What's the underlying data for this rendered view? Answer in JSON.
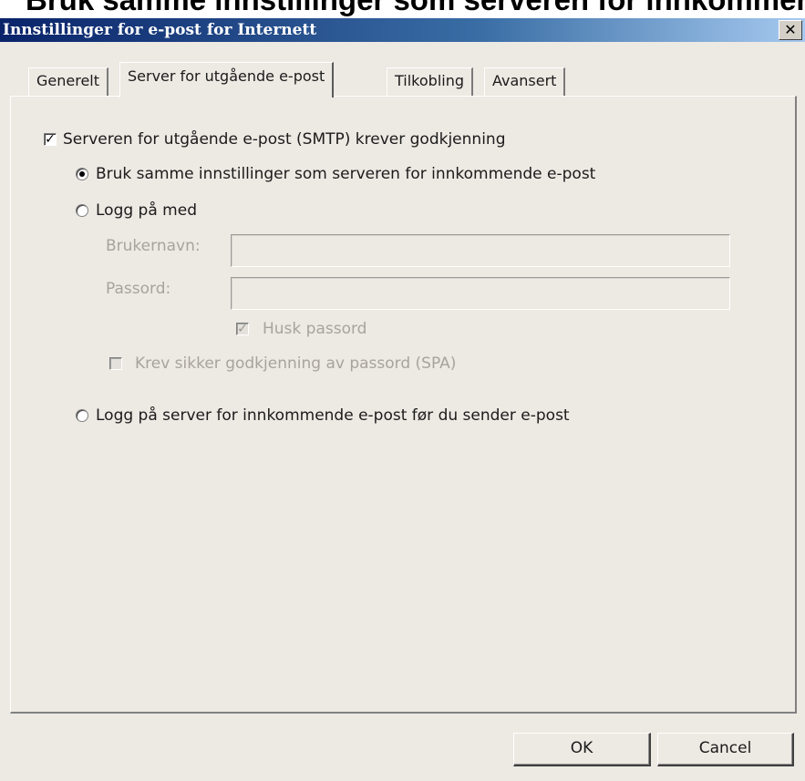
{
  "caption": "Bruk samme innstillinger som serveren for innkommende e-post",
  "window": {
    "title": "Innstillinger for e-post for Internett",
    "close_glyph": "✕",
    "close_icon": "close-icon"
  },
  "tabs": [
    {
      "label": "Generelt",
      "active": false
    },
    {
      "label": "Server for utgående e-post",
      "active": true
    },
    {
      "label": "Tilkobling",
      "active": false
    },
    {
      "label": "Avansert",
      "active": false
    }
  ],
  "panel": {
    "smtp_auth": {
      "label": "Serveren for utgående e-post (SMTP) krever godkjenning",
      "checked": true
    },
    "use_same_settings": {
      "label": "Bruk samme innstillinger som serveren for innkommende e-post",
      "selected": true
    },
    "log_on_with": {
      "label": "Logg på med",
      "selected": false
    },
    "username": {
      "label": "Brukernavn:",
      "value": "",
      "enabled": false
    },
    "password": {
      "label": "Passord:",
      "value": "",
      "enabled": false
    },
    "remember_password": {
      "label": "Husk passord",
      "checked": true,
      "enabled": false
    },
    "require_spa": {
      "label": "Krev sikker godkjenning av passord (SPA)",
      "checked": false,
      "enabled": false
    },
    "log_on_incoming_first": {
      "label": "Logg på server for innkommende e-post før du sender e-post",
      "selected": false
    }
  },
  "buttons": {
    "ok": "OK",
    "cancel": "Cancel"
  },
  "checkmark_glyph": "✓"
}
